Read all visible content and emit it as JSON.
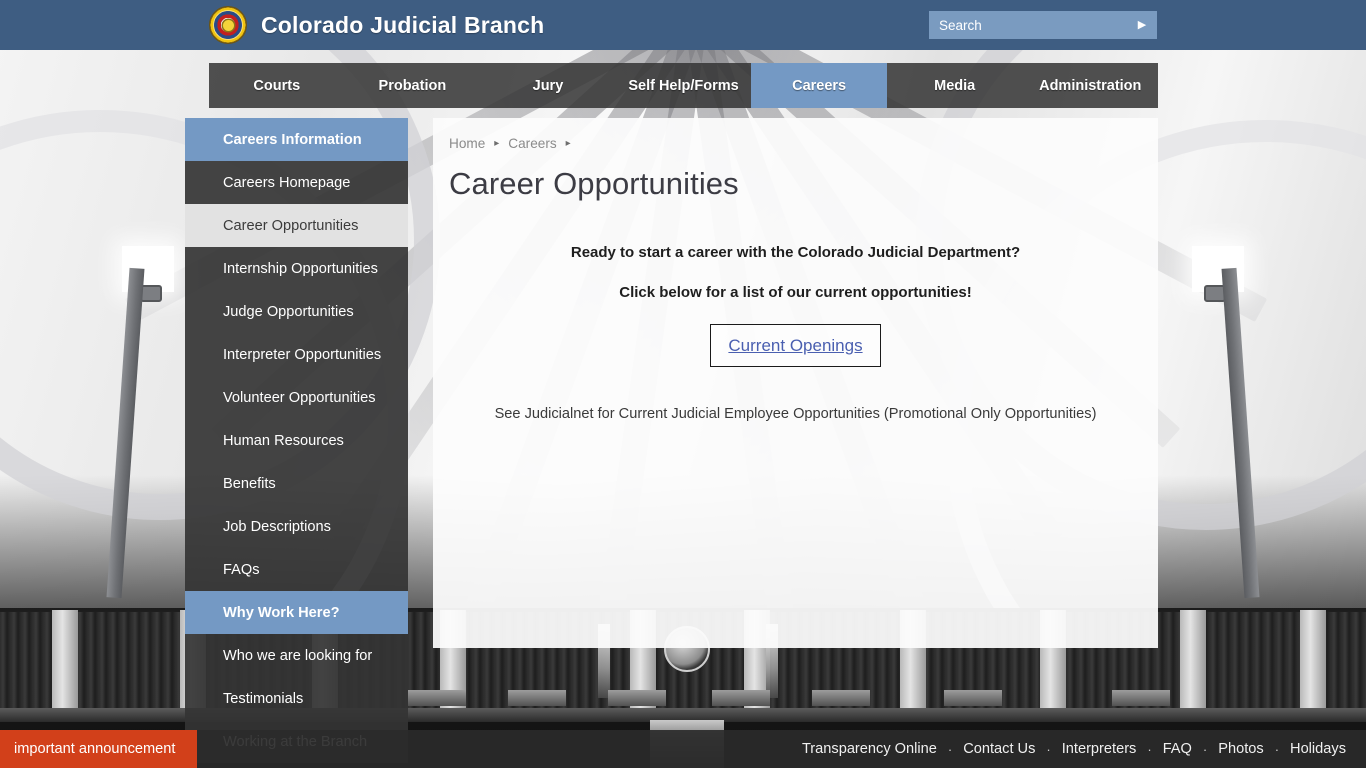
{
  "header": {
    "site_title": "Colorado Judicial Branch",
    "logo_icon": "colorado-judicial-seal-icon",
    "search": {
      "placeholder": "Search",
      "value": "",
      "submit_icon": "play-arrow-icon"
    },
    "bar_color": "#3e5d82"
  },
  "nav": {
    "items": [
      {
        "label": "Courts",
        "active": false
      },
      {
        "label": "Probation",
        "active": false
      },
      {
        "label": "Jury",
        "active": false
      },
      {
        "label": "Self Help/Forms",
        "active": false
      },
      {
        "label": "Careers",
        "active": true
      },
      {
        "label": "Media",
        "active": false
      },
      {
        "label": "Administration",
        "active": false
      }
    ],
    "active_color": "#7499c4"
  },
  "sidebar": {
    "items": [
      {
        "label": "Careers Information",
        "type": "header"
      },
      {
        "label": "Careers Homepage",
        "type": "link"
      },
      {
        "label": "Career Opportunities",
        "type": "current"
      },
      {
        "label": "Internship Opportunities",
        "type": "link"
      },
      {
        "label": "Judge Opportunities",
        "type": "link"
      },
      {
        "label": "Interpreter Opportunities",
        "type": "link"
      },
      {
        "label": "Volunteer Opportunities",
        "type": "link"
      },
      {
        "label": "Human Resources",
        "type": "link"
      },
      {
        "label": "Benefits",
        "type": "link"
      },
      {
        "label": "Job Descriptions",
        "type": "link"
      },
      {
        "label": "FAQs",
        "type": "link"
      },
      {
        "label": "Why Work Here?",
        "type": "header"
      },
      {
        "label": "Who we are looking for",
        "type": "link"
      },
      {
        "label": "Testimonials",
        "type": "link"
      },
      {
        "label": "Working at the Branch",
        "type": "link"
      }
    ]
  },
  "main": {
    "breadcrumb": {
      "home": "Home",
      "sep1": "▸",
      "section": "Careers",
      "sep2": "▸"
    },
    "page_title": "Career Opportunities",
    "promo_line_1": "Ready to start a career with the Colorado Judicial Department?",
    "promo_line_2": "Click below for a list of our current opportunities!",
    "cta_label": "Current Openings",
    "cta_color": "#4a5fb0",
    "note": "See Judicialnet for Current Judicial Employee Opportunities (Promotional Only Opportunities)"
  },
  "footer": {
    "announcement": "important announcement",
    "announcement_color": "#d2401a",
    "links": [
      "Transparency Online",
      "Contact Us",
      "Interpreters",
      "FAQ",
      "Photos",
      "Holidays"
    ],
    "separator": "·"
  }
}
